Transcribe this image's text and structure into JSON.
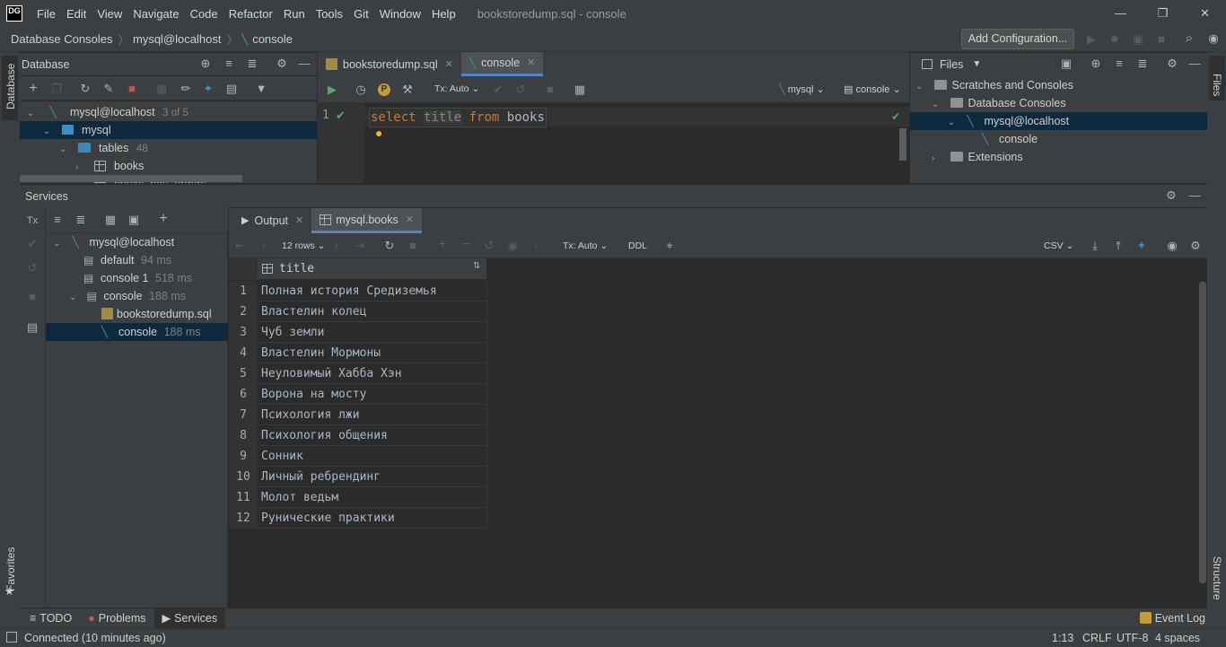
{
  "app": {
    "logo": "DG",
    "menu": [
      "File",
      "Edit",
      "View",
      "Navigate",
      "Code",
      "Refactor",
      "Run",
      "Tools",
      "Git",
      "Window",
      "Help"
    ],
    "window_title": "bookstoredump.sql - console"
  },
  "breadcrumb": [
    "Database Consoles",
    "mysql@localhost",
    "console"
  ],
  "add_configuration": "Add Configuration...",
  "database_panel": {
    "title": "Database",
    "tree": [
      {
        "label": "mysql@localhost",
        "extra": "3 of 5"
      },
      {
        "label": "mysql",
        "extra": ""
      },
      {
        "label": "tables",
        "extra": "48"
      },
      {
        "label": "books",
        "extra": ""
      },
      {
        "label": "books_has_orders",
        "extra": ""
      }
    ]
  },
  "editor": {
    "tabs": [
      {
        "label": "bookstoredump.sql"
      },
      {
        "label": "console"
      }
    ],
    "tx_mode": "Tx: Auto",
    "datasource": "mysql",
    "session": "console",
    "line_number": "1",
    "code": {
      "kw1": "select",
      "col": "title",
      "kw2": "from",
      "tbl": "books"
    }
  },
  "files_panel": {
    "title": "Files",
    "tree": [
      {
        "label": "Scratches and Consoles"
      },
      {
        "label": "Database Consoles"
      },
      {
        "label": "mysql@localhost"
      },
      {
        "label": "console"
      },
      {
        "label": "Extensions"
      }
    ]
  },
  "services_panel": {
    "title": "Services",
    "tree": [
      {
        "label": "mysql@localhost",
        "time": ""
      },
      {
        "label": "default",
        "time": "94 ms"
      },
      {
        "label": "console 1",
        "time": "518 ms"
      },
      {
        "label": "console",
        "time": "188 ms"
      },
      {
        "label": "bookstoredump.sql",
        "time": ""
      },
      {
        "label": "console",
        "time": "188 ms"
      }
    ],
    "tabs": [
      {
        "label": "Output"
      },
      {
        "label": "mysql.books"
      }
    ],
    "rows_label": "12 rows",
    "tx_mode": "Tx: Auto",
    "ddl": "DDL",
    "export_format": "CSV"
  },
  "result": {
    "column": "title",
    "rows": [
      "Полная история Средиземья",
      "Властелин колец",
      "Чуб земли",
      "Властелин Мормоны",
      "Неуловимый Хабба Хэн",
      "Ворона на мосту",
      "Психология лжи",
      "Психология общения",
      "Сонник",
      "Личный ребрендинг",
      "Молот ведьм",
      "Рунические практики"
    ]
  },
  "side_labels": {
    "database": "Database",
    "favorites": "Favorites",
    "files": "Files",
    "structure": "Structure"
  },
  "bottom_tabs": [
    {
      "label": "TODO"
    },
    {
      "label": "Problems"
    },
    {
      "label": "Services"
    }
  ],
  "event_log": "Event Log",
  "status": {
    "message": "Connected (10 minutes ago)",
    "position": "1:13",
    "line_sep": "CRLF",
    "encoding": "UTF-8",
    "indent": "4 spaces"
  }
}
